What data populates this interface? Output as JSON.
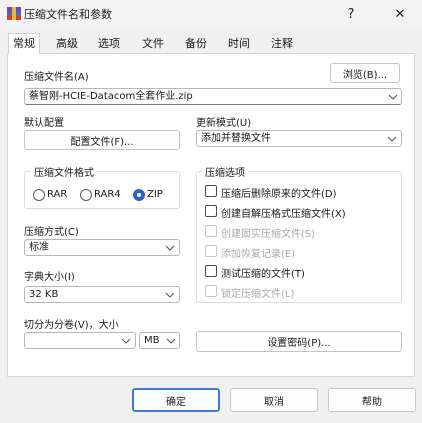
{
  "window": {
    "title": "压缩文件名和参数",
    "help_label": "?",
    "close_label": "✕"
  },
  "tabs": [
    {
      "label": "常规",
      "active": true
    },
    {
      "label": "高级"
    },
    {
      "label": "选项"
    },
    {
      "label": "文件"
    },
    {
      "label": "备份"
    },
    {
      "label": "时间"
    },
    {
      "label": "注释"
    }
  ],
  "archive": {
    "label": "压缩文件名(A)",
    "value": "蔡智刚-HCIE-Datacom全套作业.zip",
    "browse_label": "浏览(B)..."
  },
  "default_profile": {
    "label": "默认配置",
    "button_label": "配置文件(F)..."
  },
  "update_mode": {
    "label": "更新模式(U)",
    "value": "添加并替换文件"
  },
  "format": {
    "label": "压缩文件格式",
    "options": [
      {
        "label": "RAR",
        "selected": false
      },
      {
        "label": "RAR4",
        "selected": false
      },
      {
        "label": "ZIP",
        "selected": true
      }
    ]
  },
  "method": {
    "label": "压缩方式(C)",
    "value": "标准"
  },
  "dictionary": {
    "label": "字典大小(I)",
    "value": "32 KB"
  },
  "split": {
    "label": "切分为分卷(V)，大小",
    "value": "",
    "unit": "MB"
  },
  "options": {
    "label": "压缩选项",
    "items": [
      {
        "label": "压缩后删除原来的文件(D)",
        "enabled": true,
        "checked": false
      },
      {
        "label": "创建自解压格式压缩文件(X)",
        "enabled": true,
        "checked": false
      },
      {
        "label": "创建固实压缩文件(S)",
        "enabled": false,
        "checked": false
      },
      {
        "label": "添加恢复记录(E)",
        "enabled": false,
        "checked": false
      },
      {
        "label": "测试压缩的文件(T)",
        "enabled": true,
        "checked": false
      },
      {
        "label": "锁定压缩文件(L)",
        "enabled": false,
        "checked": false
      }
    ]
  },
  "password_button": "设置密码(P)...",
  "footer": {
    "ok": "确定",
    "cancel": "取消",
    "help": "帮助"
  },
  "colors": {
    "accent": "#2a62c9",
    "panel_bg": "#ffffff",
    "dialog_bg": "#f0f0f0"
  }
}
